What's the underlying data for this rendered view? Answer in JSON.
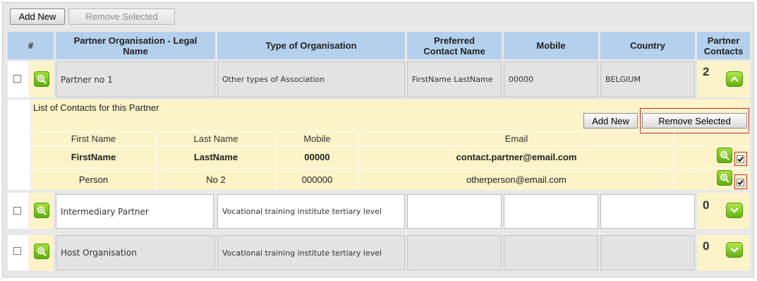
{
  "toolbar": {
    "add_new": "Add New",
    "remove_selected": "Remove Selected"
  },
  "table": {
    "headers": {
      "num": "#",
      "legal_name": "Partner Organisation - Legal Name",
      "type": "Type of Organisation",
      "contact": "Preferred Contact Name",
      "mobile": "Mobile",
      "country": "Country",
      "contacts": "Partner Contacts"
    },
    "rows": [
      {
        "name": "Partner no 1",
        "type": "Other types of Association",
        "contact": "FirstName LastName",
        "mobile": "00000",
        "country": "BELGIUM",
        "count": "2",
        "expanded": true
      },
      {
        "name": "Intermediary Partner",
        "type": "Vocational training institute tertiary level",
        "contact": "",
        "mobile": "",
        "country": "",
        "count": "0",
        "expanded": false
      },
      {
        "name": "Host Organisation",
        "type": "Vocational training institute tertiary level",
        "contact": "",
        "mobile": "",
        "country": "",
        "count": "0",
        "expanded": false
      }
    ]
  },
  "contacts_panel": {
    "title": "List of Contacts for this Partner",
    "add_new": "Add New",
    "remove_selected": "Remove Selected",
    "columns": {
      "first": "First Name",
      "last": "Last Name",
      "mobile": "Mobile",
      "email": "Email"
    },
    "rows": [
      {
        "first": "FirstName",
        "last": "LastName",
        "mobile": "00000",
        "email": "contact.partner@email.com",
        "bold": true,
        "checked": true
      },
      {
        "first": "Person",
        "last": "No 2",
        "mobile": "000000",
        "email": "otherperson@email.com",
        "bold": false,
        "checked": true
      }
    ]
  },
  "colors": {
    "header_blue": "#b4d0ed",
    "panel_yellow": "#fdf3c8",
    "accent_green": "#6cbc14",
    "highlight_red": "#c0272d"
  },
  "icons": {
    "zoom": "zoom-icon",
    "collapse": "chevron-up-icon",
    "expand": "chevron-down-icon"
  }
}
